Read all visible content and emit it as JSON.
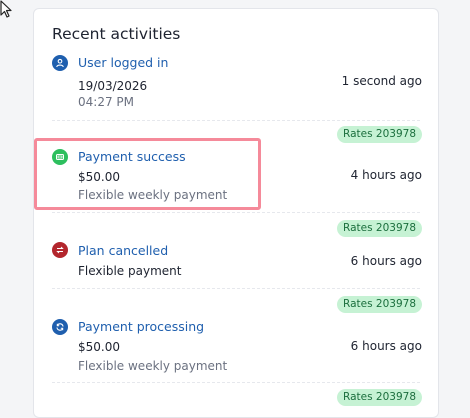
{
  "card": {
    "title": "Recent activities"
  },
  "activities": [
    {
      "icon": "user-icon",
      "icon_color": "#1f5fae",
      "title": "User logged in",
      "lines": [
        "19/03/2026",
        "04:27 PM"
      ],
      "time": "1 second ago",
      "badge": ""
    },
    {
      "icon": "payment-card-icon",
      "icon_color": "#2dbf5e",
      "title": "Payment success",
      "lines": [
        "$50.00",
        "Flexible weekly payment"
      ],
      "time": "4 hours ago",
      "badge": "Rates 203978"
    },
    {
      "icon": "cancel-arrows-icon",
      "icon_color": "#b3262d",
      "title": "Plan cancelled",
      "lines": [
        "Flexible payment"
      ],
      "time": "6 hours ago",
      "badge": "Rates 203978"
    },
    {
      "icon": "refresh-icon",
      "icon_color": "#1f5fae",
      "title": "Payment processing",
      "lines": [
        "$50.00",
        "Flexible weekly payment"
      ],
      "time": "6 hours ago",
      "badge": "Rates 203978"
    },
    {
      "icon": "",
      "title": "",
      "lines": [],
      "time": "",
      "badge": "Rates 203978"
    }
  ],
  "colors": {
    "link": "#1f5fae",
    "badge_bg": "#c6f2d4",
    "badge_text": "#1b6e3d",
    "highlight": "#f58a9a"
  }
}
